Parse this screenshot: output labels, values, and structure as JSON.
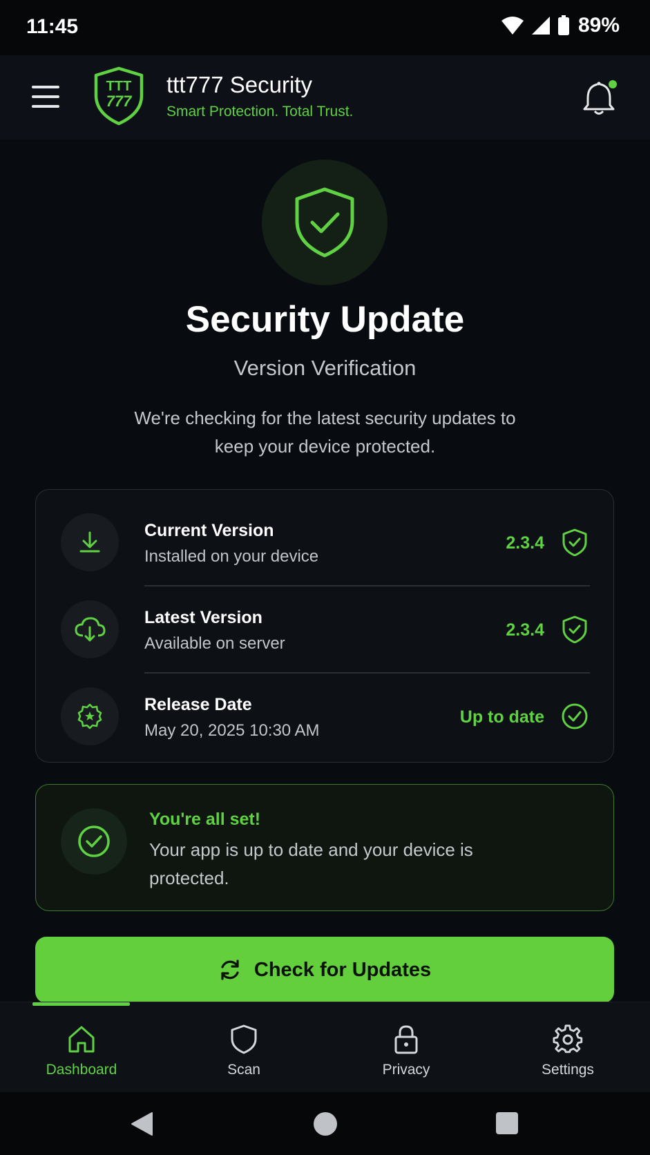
{
  "status_bar": {
    "time": "11:45",
    "battery": "89%"
  },
  "app_bar": {
    "logo_text_top": "TTT",
    "logo_text_bottom": "777",
    "title": "ttt777 Security",
    "subtitle": "Smart Protection. Total Trust.",
    "notification_dot_color": "#5fd143"
  },
  "hero": {
    "title": "Security Update",
    "subtitle": "Version Verification",
    "description": "We're checking for the latest security updates to keep your device protected."
  },
  "info_rows": [
    {
      "icon": "download-icon",
      "label": "Current Version",
      "sub": "Installed on your device",
      "value": "2.3.4",
      "status_icon": "shield-check-icon"
    },
    {
      "icon": "cloud-download-icon",
      "label": "Latest Version",
      "sub": "Available on server",
      "value": "2.3.4",
      "status_icon": "shield-check-icon"
    },
    {
      "icon": "badge-star-icon",
      "label": "Release Date",
      "sub": "May 20, 2025 10:30 AM",
      "value": "Up to date",
      "status_icon": "check-circle-icon"
    }
  ],
  "success": {
    "title": "You're all set!",
    "text": "Your app is up to date and your device is protected."
  },
  "cta": {
    "label": "Check for Updates",
    "icon": "refresh-icon"
  },
  "bottom_nav": [
    {
      "label": "Dashboard",
      "icon": "home-icon",
      "active": true
    },
    {
      "label": "Scan",
      "icon": "shield-icon",
      "active": false
    },
    {
      "label": "Privacy",
      "icon": "lock-icon",
      "active": false
    },
    {
      "label": "Settings",
      "icon": "gear-icon",
      "active": false
    }
  ],
  "colors": {
    "accent": "#5fd143",
    "background": "#080b10",
    "cta": "#63cf3c"
  }
}
